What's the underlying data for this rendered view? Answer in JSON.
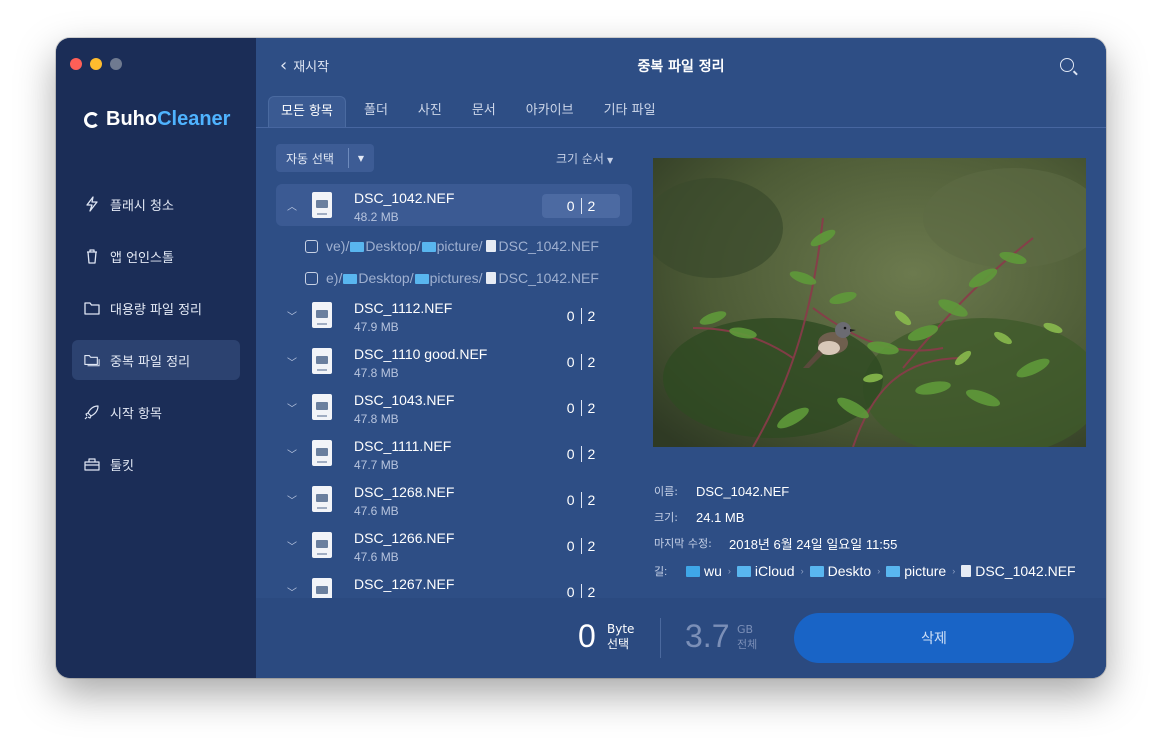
{
  "window": {
    "brand_part1": "Buho",
    "brand_part2": "Cleaner"
  },
  "sidebar": {
    "items": [
      {
        "label": "플래시 청소",
        "icon": "lightning-icon"
      },
      {
        "label": "앱 언인스톨",
        "icon": "trash-icon"
      },
      {
        "label": "대용량 파일 정리",
        "icon": "folder-icon"
      },
      {
        "label": "중복 파일 정리",
        "icon": "duplicate-folder-icon",
        "active": true
      },
      {
        "label": "시작 항목",
        "icon": "rocket-icon"
      },
      {
        "label": "툴킷",
        "icon": "toolbox-icon"
      }
    ]
  },
  "header": {
    "back_label": "재시작",
    "title": "중복 파일 정리"
  },
  "tabs": [
    "모든 항목",
    "폴더",
    "사진",
    "문서",
    "아카이브",
    "기타 파일"
  ],
  "toolbar": {
    "auto_select": "자동 선택",
    "sort": "크기 순서"
  },
  "files": [
    {
      "name": "DSC_1042.NEF",
      "size": "48.2 MB",
      "selected": "0",
      "total": "2",
      "expanded": true,
      "paths": [
        {
          "prefix": "ve)/",
          "seg1": "Desktop/",
          "seg2": "picture/",
          "file": "DSC_1042.NEF"
        },
        {
          "prefix": "e)/",
          "seg1": "Desktop/",
          "seg2": "pictures/",
          "file": "DSC_1042.NEF"
        }
      ]
    },
    {
      "name": "DSC_1112.NEF",
      "size": "47.9 MB",
      "selected": "0",
      "total": "2"
    },
    {
      "name": "DSC_1110 good.NEF",
      "size": "47.8 MB",
      "selected": "0",
      "total": "2"
    },
    {
      "name": "DSC_1043.NEF",
      "size": "47.8 MB",
      "selected": "0",
      "total": "2"
    },
    {
      "name": "DSC_1111.NEF",
      "size": "47.7 MB",
      "selected": "0",
      "total": "2"
    },
    {
      "name": "DSC_1268.NEF",
      "size": "47.6 MB",
      "selected": "0",
      "total": "2"
    },
    {
      "name": "DSC_1266.NEF",
      "size": "47.6 MB",
      "selected": "0",
      "total": "2"
    },
    {
      "name": "DSC_1267.NEF",
      "size": "",
      "selected": "0",
      "total": "2"
    }
  ],
  "details": {
    "name_label": "이름:",
    "name_value": "DSC_1042.NEF",
    "size_label": "크기:",
    "size_value": "24.1 MB",
    "modified_label": "마지막 수정:",
    "modified_value": "2018년 6월 24일 일요일 11:55",
    "path_label": "길:",
    "path": [
      "wu",
      "iCloud",
      "Deskto",
      "picture",
      "DSC_1042.NEF"
    ]
  },
  "footer": {
    "selected_value": "0",
    "selected_unit": "Byte",
    "selected_caption": "선택",
    "total_value": "3.7",
    "total_unit": "GB",
    "total_caption": "전체",
    "delete_label": "삭제"
  }
}
